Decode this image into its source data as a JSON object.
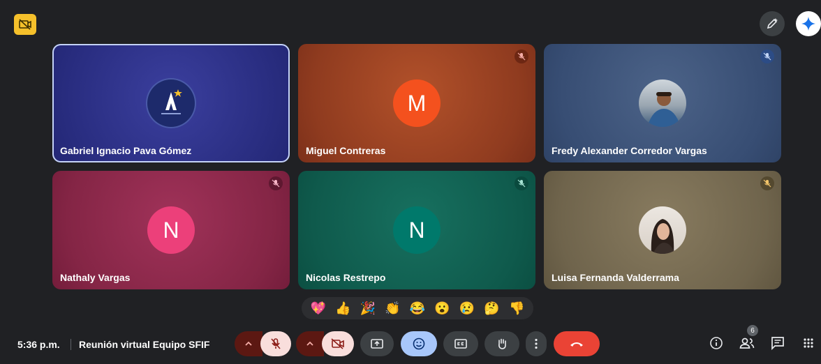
{
  "participants": [
    {
      "name": "Gabriel Ignacio Pava Gómez",
      "avatar_type": "logo",
      "muted": false
    },
    {
      "name": "Miguel Contreras",
      "initial": "M",
      "avatar_color": "#f4511e",
      "muted": true
    },
    {
      "name": "Fredy Alexander Corredor Vargas",
      "avatar_type": "photo",
      "muted": true
    },
    {
      "name": "Nathaly Vargas",
      "initial": "N",
      "avatar_color": "#ec407a",
      "muted": true
    },
    {
      "name": "Nicolas Restrepo",
      "initial": "N",
      "avatar_color": "#00796b",
      "muted": true
    },
    {
      "name": "Luisa Fernanda Valderrama",
      "avatar_type": "photo",
      "muted": true
    }
  ],
  "reactions": [
    "💖",
    "👍",
    "🎉",
    "👏",
    "😂",
    "😮",
    "😢",
    "🤔",
    "👎"
  ],
  "bottom_bar": {
    "time": "5:36 p.m.",
    "meeting_name": "Reunión virtual Equipo SFIF",
    "participant_count": "6"
  },
  "top_bar": {
    "icons": [
      "recording-indicator-icon",
      "pen-icon",
      "gemini-icon"
    ]
  },
  "colors": {
    "background": "#202124",
    "mic_off_bg": "#f9dedc",
    "chevron_bg": "#8c1d18",
    "leave_red": "#ea4335",
    "emoji_active": "#a8c7fa"
  }
}
